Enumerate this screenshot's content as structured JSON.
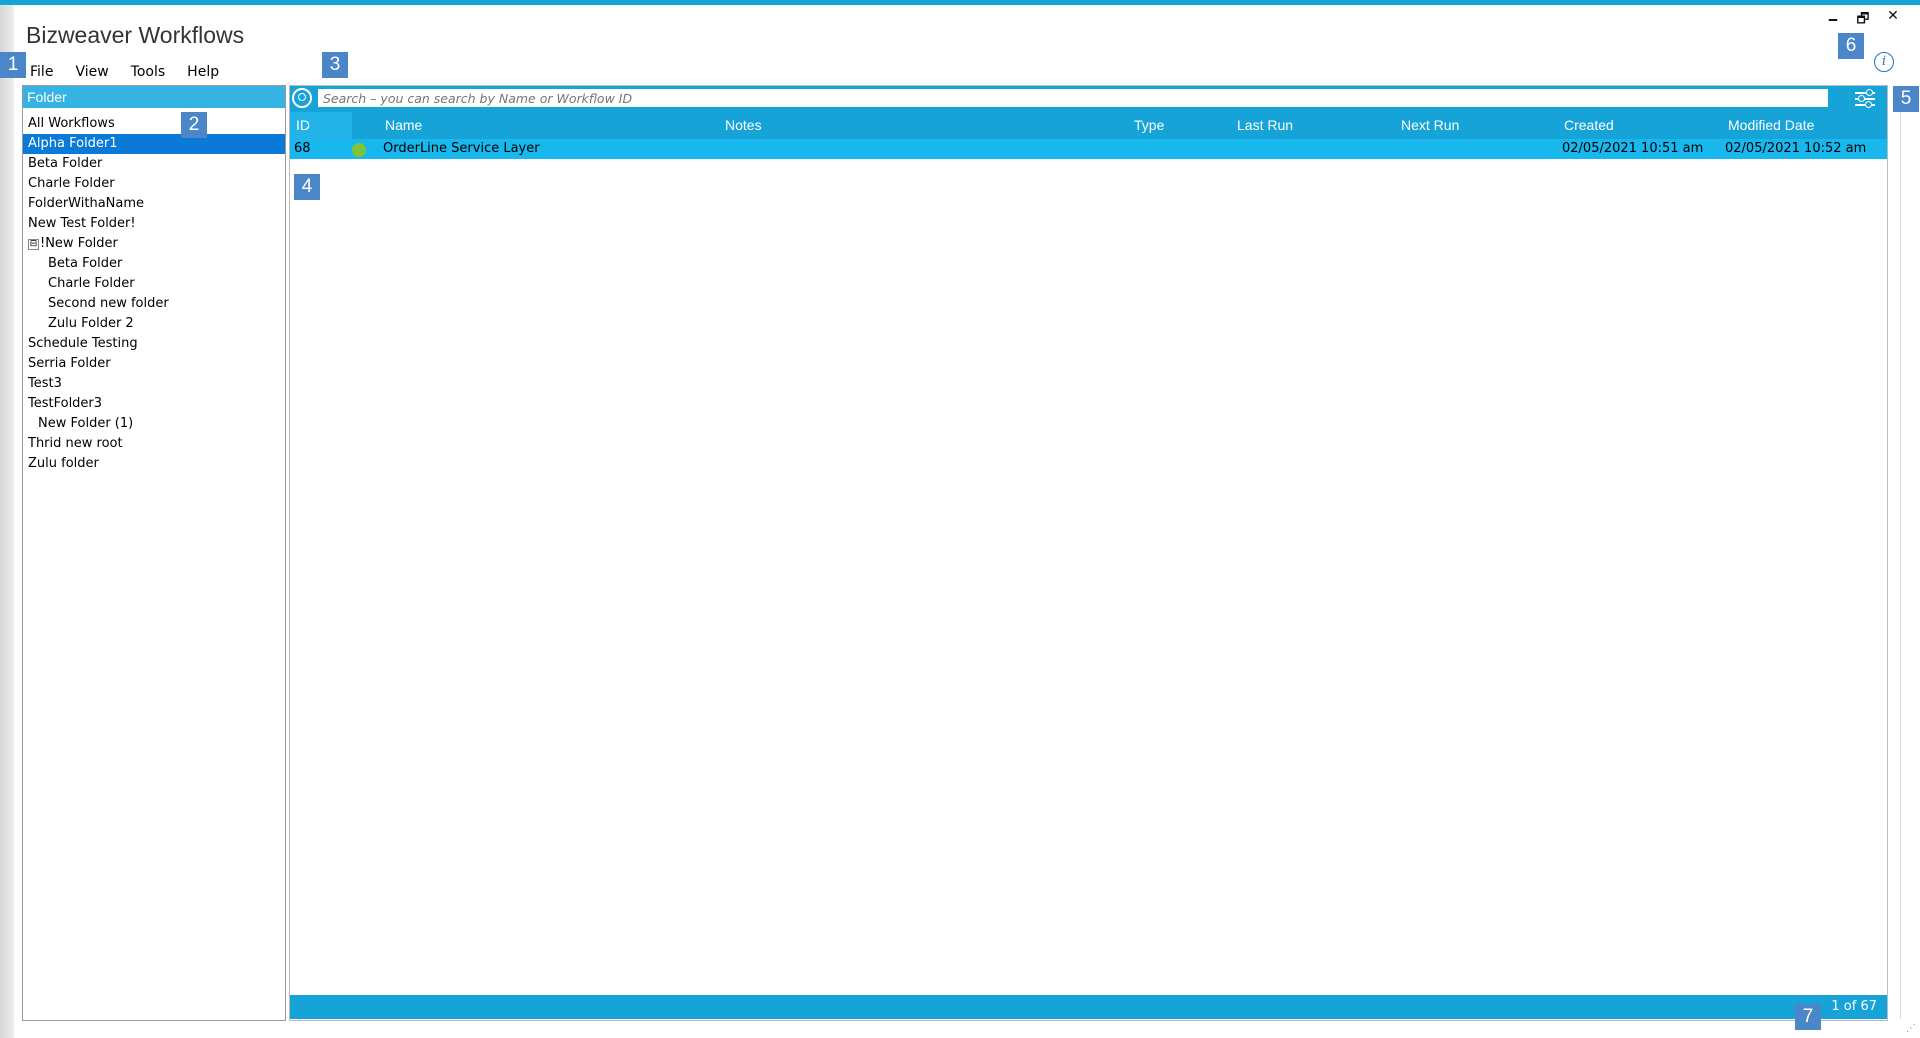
{
  "app": {
    "title": "Bizweaver Workflows"
  },
  "window_controls": {
    "minimize": "🗕",
    "restore": "🗗",
    "close": "✕"
  },
  "menu": [
    "File",
    "View",
    "Tools",
    "Help"
  ],
  "callouts": [
    "1",
    "2",
    "3",
    "4",
    "5",
    "6",
    "7"
  ],
  "info_icon": "i",
  "folders": {
    "header": "Folder",
    "items": [
      {
        "label": "All Workflows"
      },
      {
        "label": "Alpha Folder1",
        "selected": true
      },
      {
        "label": "Beta Folder"
      },
      {
        "label": "Charle Folder"
      },
      {
        "label": "FolderWithaName"
      },
      {
        "label": "New Test Folder!"
      },
      {
        "label": "!New Folder",
        "toggle": "⊟"
      },
      {
        "label": "Beta Folder",
        "child": true
      },
      {
        "label": "Charle Folder",
        "child": true
      },
      {
        "label": "Second new folder",
        "child": true
      },
      {
        "label": "Zulu Folder 2",
        "child": true
      },
      {
        "label": "Schedule Testing"
      },
      {
        "label": "Serria Folder"
      },
      {
        "label": "Test3"
      },
      {
        "label": "TestFolder3"
      },
      {
        "label": "New Folder (1)",
        "child_shallow": true
      },
      {
        "label": "Thrid new root"
      },
      {
        "label": "Zulu folder"
      }
    ]
  },
  "search": {
    "placeholder": "Search – you can search by Name or Workflow ID",
    "value": ""
  },
  "grid": {
    "columns": [
      "ID",
      "Name",
      "Notes",
      "Type",
      "Last Run",
      "Next Run",
      "Created",
      "Modified Date"
    ],
    "rows": [
      {
        "id": "68",
        "status_color": "#7ec43a",
        "name": "OrderLine Service Layer",
        "notes": "",
        "type": "",
        "last_run": "",
        "next_run": "",
        "created": "02/05/2021 10:51 am",
        "modified": "02/05/2021 10:52 am"
      }
    ]
  },
  "footer": {
    "page": "1 of 67"
  },
  "colors": {
    "accent": "#16a3d7",
    "selected": "#0a7ad6",
    "callout": "#4a86c8",
    "status_ok": "#7ec43a"
  }
}
